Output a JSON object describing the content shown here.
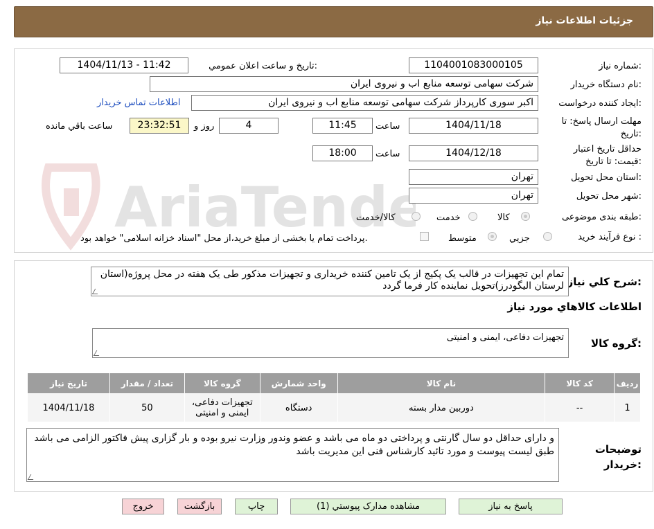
{
  "header": {
    "title": "جزئیات اطلاعات نیاز"
  },
  "watermark_text": "AriaTender.neT",
  "form": {
    "need_number_label": "شماره نیاز:",
    "need_number": "1104001083000105",
    "announce_label": "تاریخ و ساعت اعلان عمومي:",
    "announce_value": "1404/11/13 - 11:42",
    "buyer_org_label": "نام دستگاه خريدار:",
    "buyer_org": "شرکت سهامی توسعه منابع اب و نیروی ایران",
    "requester_label": "ایجاد کننده درخواست:",
    "requester": "اکبر سوری کارپرداز شرکت سهامی توسعه منابع اب و نیروی ایران",
    "contact_link": "اطلاعات تماس خريدار",
    "deadline_label": "مهلت ارسال پاسخ: تا تاریخ:",
    "deadline_date": "1404/11/18",
    "time_label": "ساعت",
    "deadline_time": "11:45",
    "days_value": "4",
    "days_label": "روز و",
    "remaining_time": "23:32:51",
    "remaining_label": "ساعت باقي مانده",
    "price_valid_label": "حداقل تاريخ اعتبار قيمت: تا تاريخ:",
    "price_valid_date": "1404/12/18",
    "price_valid_time": "18:00",
    "province_label": "استان محل تحویل:",
    "province": "تهران",
    "city_label": "شهر محل تحویل:",
    "city": "تهران",
    "category_label": "طبقه بندی موضوعی:",
    "category_options": [
      "کالا",
      "خدمت",
      "کالا/خدمت"
    ],
    "process_label": "نوع فرآیند خرید :",
    "process_options": [
      "جزیي",
      "متوسط"
    ],
    "payment_note": "پرداخت تمام یا بخشی از مبلغ خرید،از محل \"اسناد خزانه اسلامی\" خواهد بود."
  },
  "description": {
    "label": "شرح کلي نياز:",
    "text": "تمام این تجهیزات در قالب یک پکیج از یک تامین کننده خریداری و تجهیزات مذکور طی یک هفته در محل پروژه(استان لرستان  الیگودرز)تحویل نماینده کار فرما گردد"
  },
  "goods_section_title": "اطلاعات کالاهاي مورد نياز",
  "goods_group": {
    "label": "گروه کالا:",
    "value": "تجهیزات دفاعی، ایمنی و امنیتی"
  },
  "table": {
    "headers": [
      "رديف",
      "کد کالا",
      "نام کالا",
      "واحد شمارش",
      "گروه کالا",
      "تعداد / مقدار",
      "تاریخ نیاز"
    ],
    "rows": [
      [
        "1",
        "--",
        "دوربین مدار بسته",
        "دستگاه",
        "تجهیزات دفاعی، ایمنی و امنیتی",
        "50",
        "1404/11/18"
      ]
    ]
  },
  "buyer_notes": {
    "label": "توضيحات خريدار:",
    "text": "و دارای حداقل دو سال گارنتی و پرداختی دو ماه می باشد و عضو وندور وزارت نیرو بوده و بار گزاری پیش فاکتور الزامی می باشد طبق لیست پیوست و مورد تائید کارشناس فنی این مدیریت باشد"
  },
  "buttons": {
    "reply": "پاسخ به نياز",
    "attachments": "مشاهده مدارک پيوستي (1)",
    "print": "چاپ",
    "back": "بازگشت",
    "exit": "خروج"
  }
}
